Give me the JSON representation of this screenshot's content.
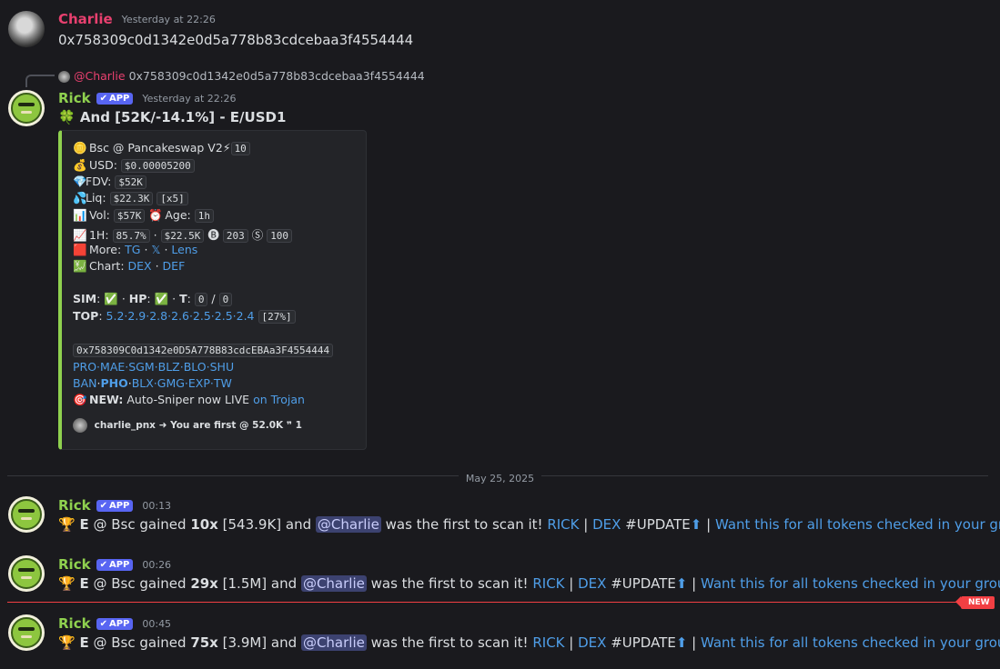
{
  "msg1": {
    "user": "Charlie",
    "time": "Yesterday at 22:26",
    "text": "0x758309c0d1342e0d5a778b83cdcebaa3f4554444"
  },
  "reply": {
    "mention": "@Charlie",
    "text": "0x758309c0d1342e0d5a778b83cdcebaa3f4554444"
  },
  "msg2": {
    "user": "Rick",
    "badge": "APP",
    "time": "Yesterday at 22:26",
    "title_emoji": "🍀",
    "title": "And [52K/-14.1%] - E/USD1"
  },
  "embed": {
    "chain": "Bsc @ Pancakeswap V2",
    "chain_count": "10",
    "usd_label": "USD:",
    "usd": "$0.00005200",
    "fdv_label": "FDV:",
    "fdv": "$52K",
    "liq_label": "Liq:",
    "liq": "$22.3K",
    "liq_mult": "[x5]",
    "vol_label": "Vol:",
    "vol": "$57K",
    "age_label": "Age:",
    "age": "1h",
    "h1_label": "1H:",
    "h1_pct": "85.7%",
    "h1_vol": "$22.5K",
    "h1_buys": "203",
    "h1_sells": "100",
    "more_label": "More:",
    "more_tg": "TG",
    "more_x": "𝕏",
    "more_lens": "Lens",
    "chart_label": "Chart:",
    "chart_dex": "DEX",
    "chart_def": "DEF",
    "sim_label": "SIM",
    "hp_label": "HP",
    "t_label": "T",
    "t_value": "0",
    "t_value2": "0",
    "top_label": "TOP",
    "top_values": "5.2·2.9·2.8·2.6·2.5·2.5·2.4",
    "top_pct": "[27%]",
    "address": "0x758309C0d1342e0D5A778B83cdcEBAa3F4554444",
    "links1": "PRO·MAE·SGM·BLZ·BLO·SHU",
    "links2_a": "BAN",
    "links2_b": "PHO",
    "links2_c": "BLX·GMG·EXP·TW",
    "new_label": "NEW:",
    "new_text": "Auto-Sniper now LIVE",
    "new_link": "on Trojan",
    "footer_user": "charlie_pnx",
    "footer_text": "You are first @ 52.0K",
    "footer_count": "1"
  },
  "date_sep": "May 25, 2025",
  "updates": [
    {
      "user": "Rick",
      "badge": "APP",
      "time": "00:13",
      "token": "E",
      "mid": "@ Bsc gained",
      "mult": "10x",
      "mcap": "[543.9K] and",
      "mention": "@Charlie",
      "tail": "was the first to scan it!",
      "rick": "RICK",
      "dex": "DEX",
      "tag": "#UPDATE",
      "cta": "Want this for all tokens checked in your group?"
    },
    {
      "user": "Rick",
      "badge": "APP",
      "time": "00:26",
      "token": "E",
      "mid": "@ Bsc gained",
      "mult": "29x",
      "mcap": "[1.5M] and",
      "mention": "@Charlie",
      "tail": "was the first to scan it!",
      "rick": "RICK",
      "dex": "DEX",
      "tag": "#UPDATE",
      "cta": "Want this for all tokens checked in your group?"
    },
    {
      "user": "Rick",
      "badge": "APP",
      "time": "00:45",
      "token": "E",
      "mid": "@ Bsc gained",
      "mult": "75x",
      "mcap": "[3.9M] and",
      "mention": "@Charlie",
      "tail": "was the first to scan it!",
      "rick": "RICK",
      "dex": "DEX",
      "tag": "#UPDATE",
      "cta": "Want this for all tokens checked in your group?"
    }
  ],
  "new_badge": "NEW",
  "colors": {
    "accent_green": "#8fd14f",
    "charlie": "#e8406f",
    "link": "#4f9ee8",
    "new": "#f23f43"
  }
}
